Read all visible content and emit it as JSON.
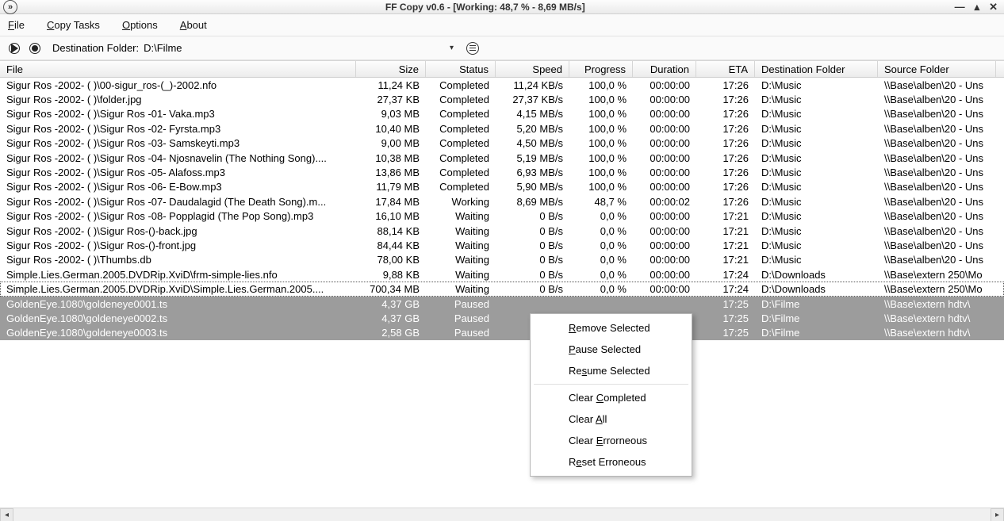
{
  "title": "FF Copy v0.6 - [Working: 48,7 % - 8,69 MB/s]",
  "menu": {
    "file": "File",
    "copy_tasks": "Copy Tasks",
    "options": "Options",
    "about": "About"
  },
  "toolbar": {
    "dest_label": "Destination Folder:",
    "dest_value": "D:\\Filme"
  },
  "columns": {
    "file": "File",
    "size": "Size",
    "status": "Status",
    "speed": "Speed",
    "progress": "Progress",
    "duration": "Duration",
    "eta": "ETA",
    "dest": "Destination Folder",
    "src": "Source Folder"
  },
  "rows": [
    {
      "file": "Sigur Ros -2002- ( )\\00-sigur_ros-(_)-2002.nfo",
      "size": "11,24 KB",
      "status": "Completed",
      "speed": "11,24 KB/s",
      "progress": "100,0 %",
      "duration": "00:00:00",
      "eta": "17:26",
      "dest": "D:\\Music",
      "src": "\\\\Base\\alben\\20 - Uns",
      "selected": false
    },
    {
      "file": "Sigur Ros -2002- ( )\\folder.jpg",
      "size": "27,37 KB",
      "status": "Completed",
      "speed": "27,37 KB/s",
      "progress": "100,0 %",
      "duration": "00:00:00",
      "eta": "17:26",
      "dest": "D:\\Music",
      "src": "\\\\Base\\alben\\20 - Uns",
      "selected": false
    },
    {
      "file": "Sigur Ros -2002- ( )\\Sigur Ros -01- Vaka.mp3",
      "size": "9,03 MB",
      "status": "Completed",
      "speed": "4,15 MB/s",
      "progress": "100,0 %",
      "duration": "00:00:00",
      "eta": "17:26",
      "dest": "D:\\Music",
      "src": "\\\\Base\\alben\\20 - Uns",
      "selected": false
    },
    {
      "file": "Sigur Ros -2002- ( )\\Sigur Ros -02- Fyrsta.mp3",
      "size": "10,40 MB",
      "status": "Completed",
      "speed": "5,20 MB/s",
      "progress": "100,0 %",
      "duration": "00:00:00",
      "eta": "17:26",
      "dest": "D:\\Music",
      "src": "\\\\Base\\alben\\20 - Uns",
      "selected": false
    },
    {
      "file": "Sigur Ros -2002- ( )\\Sigur Ros -03- Samskeyti.mp3",
      "size": "9,00 MB",
      "status": "Completed",
      "speed": "4,50 MB/s",
      "progress": "100,0 %",
      "duration": "00:00:00",
      "eta": "17:26",
      "dest": "D:\\Music",
      "src": "\\\\Base\\alben\\20 - Uns",
      "selected": false
    },
    {
      "file": "Sigur Ros -2002- ( )\\Sigur Ros -04- Njosnavelin (The Nothing Song)....",
      "size": "10,38 MB",
      "status": "Completed",
      "speed": "5,19 MB/s",
      "progress": "100,0 %",
      "duration": "00:00:00",
      "eta": "17:26",
      "dest": "D:\\Music",
      "src": "\\\\Base\\alben\\20 - Uns",
      "selected": false
    },
    {
      "file": "Sigur Ros -2002- ( )\\Sigur Ros -05- Alafoss.mp3",
      "size": "13,86 MB",
      "status": "Completed",
      "speed": "6,93 MB/s",
      "progress": "100,0 %",
      "duration": "00:00:00",
      "eta": "17:26",
      "dest": "D:\\Music",
      "src": "\\\\Base\\alben\\20 - Uns",
      "selected": false
    },
    {
      "file": "Sigur Ros -2002- ( )\\Sigur Ros -06- E-Bow.mp3",
      "size": "11,79 MB",
      "status": "Completed",
      "speed": "5,90 MB/s",
      "progress": "100,0 %",
      "duration": "00:00:00",
      "eta": "17:26",
      "dest": "D:\\Music",
      "src": "\\\\Base\\alben\\20 - Uns",
      "selected": false
    },
    {
      "file": "Sigur Ros -2002- ( )\\Sigur Ros -07- Daudalagid (The Death Song).m...",
      "size": "17,84 MB",
      "status": "Working",
      "speed": "8,69 MB/s",
      "progress": "48,7 %",
      "duration": "00:00:02",
      "eta": "17:26",
      "dest": "D:\\Music",
      "src": "\\\\Base\\alben\\20 - Uns",
      "selected": false
    },
    {
      "file": "Sigur Ros -2002- ( )\\Sigur Ros -08- Popplagid (The Pop Song).mp3",
      "size": "16,10 MB",
      "status": "Waiting",
      "speed": "0 B/s",
      "progress": "0,0 %",
      "duration": "00:00:00",
      "eta": "17:21",
      "dest": "D:\\Music",
      "src": "\\\\Base\\alben\\20 - Uns",
      "selected": false
    },
    {
      "file": "Sigur Ros -2002- ( )\\Sigur Ros-()-back.jpg",
      "size": "88,14 KB",
      "status": "Waiting",
      "speed": "0 B/s",
      "progress": "0,0 %",
      "duration": "00:00:00",
      "eta": "17:21",
      "dest": "D:\\Music",
      "src": "\\\\Base\\alben\\20 - Uns",
      "selected": false
    },
    {
      "file": "Sigur Ros -2002- ( )\\Sigur Ros-()-front.jpg",
      "size": "84,44 KB",
      "status": "Waiting",
      "speed": "0 B/s",
      "progress": "0,0 %",
      "duration": "00:00:00",
      "eta": "17:21",
      "dest": "D:\\Music",
      "src": "\\\\Base\\alben\\20 - Uns",
      "selected": false
    },
    {
      "file": "Sigur Ros -2002- ( )\\Thumbs.db",
      "size": "78,00 KB",
      "status": "Waiting",
      "speed": "0 B/s",
      "progress": "0,0 %",
      "duration": "00:00:00",
      "eta": "17:21",
      "dest": "D:\\Music",
      "src": "\\\\Base\\alben\\20 - Uns",
      "selected": false
    },
    {
      "file": "Simple.Lies.German.2005.DVDRip.XviD\\frm-simple-lies.nfo",
      "size": "9,88 KB",
      "status": "Waiting",
      "speed": "0 B/s",
      "progress": "0,0 %",
      "duration": "00:00:00",
      "eta": "17:24",
      "dest": "D:\\Downloads",
      "src": "\\\\Base\\extern 250\\Mo",
      "selected": false
    },
    {
      "file": "Simple.Lies.German.2005.DVDRip.XviD\\Simple.Lies.German.2005....",
      "size": "700,34 MB",
      "status": "Waiting",
      "speed": "0 B/s",
      "progress": "0,0 %",
      "duration": "00:00:00",
      "eta": "17:24",
      "dest": "D:\\Downloads",
      "src": "\\\\Base\\extern 250\\Mo",
      "selected": false,
      "focus": true
    },
    {
      "file": "GoldenEye.1080\\goldeneye0001.ts",
      "size": "4,37 GB",
      "status": "Paused",
      "speed": "",
      "progress": "",
      "duration": "",
      "eta": "17:25",
      "dest": "D:\\Filme",
      "src": "\\\\Base\\extern hdtv\\",
      "selected": true
    },
    {
      "file": "GoldenEye.1080\\goldeneye0002.ts",
      "size": "4,37 GB",
      "status": "Paused",
      "speed": "",
      "progress": "",
      "duration": "",
      "eta": "17:25",
      "dest": "D:\\Filme",
      "src": "\\\\Base\\extern hdtv\\",
      "selected": true
    },
    {
      "file": "GoldenEye.1080\\goldeneye0003.ts",
      "size": "2,58 GB",
      "status": "Paused",
      "speed": "",
      "progress": "",
      "duration": "",
      "eta": "17:25",
      "dest": "D:\\Filme",
      "src": "\\\\Base\\extern hdtv\\",
      "selected": true
    }
  ],
  "ctxmenu": {
    "remove": "Remove Selected",
    "pause": "Pause Selected",
    "resume": "Resume Selected",
    "clear_completed": "Clear Completed",
    "clear_all": "Clear All",
    "clear_err": "Clear Errorneous",
    "reset_err": "Reset Erroneous"
  }
}
